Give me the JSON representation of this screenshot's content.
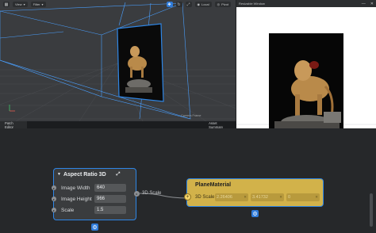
{
  "viewport": {
    "toolbar": {
      "view_label": "View",
      "filter_label": "Filter",
      "local_label": "Local",
      "pivot_label": "Pivot"
    },
    "camera_frame_label": "Camera Frame"
  },
  "simulator": {
    "title": "Resizable Window",
    "close_glyph": "✕",
    "minimize_glyph": "—",
    "footer_icons": [
      "camera-icon",
      "rotate-icon"
    ]
  },
  "patch_editor": {
    "tabs": [
      {
        "label": "Patch Editor",
        "active": true
      },
      {
        "label": "Asset Summary",
        "active": false
      }
    ],
    "nodes": {
      "aspect_ratio": {
        "title": "Aspect Ratio 3D",
        "collapse_glyph": "▼",
        "fields": [
          {
            "label": "Image Width",
            "value": "640"
          },
          {
            "label": "Image Height",
            "value": "966"
          },
          {
            "label": "Scale",
            "value": "1.5"
          }
        ],
        "output_label": "3D Scale"
      },
      "plane_material": {
        "title": "PlaneMaterial",
        "input_label": "3D Scale",
        "values": [
          "2.26406",
          "3.41732",
          "0"
        ]
      }
    }
  },
  "colors": {
    "selection_blue": "#2e86e6",
    "material_node": "#d2b24a",
    "wireframe": "#4aa0ff"
  }
}
